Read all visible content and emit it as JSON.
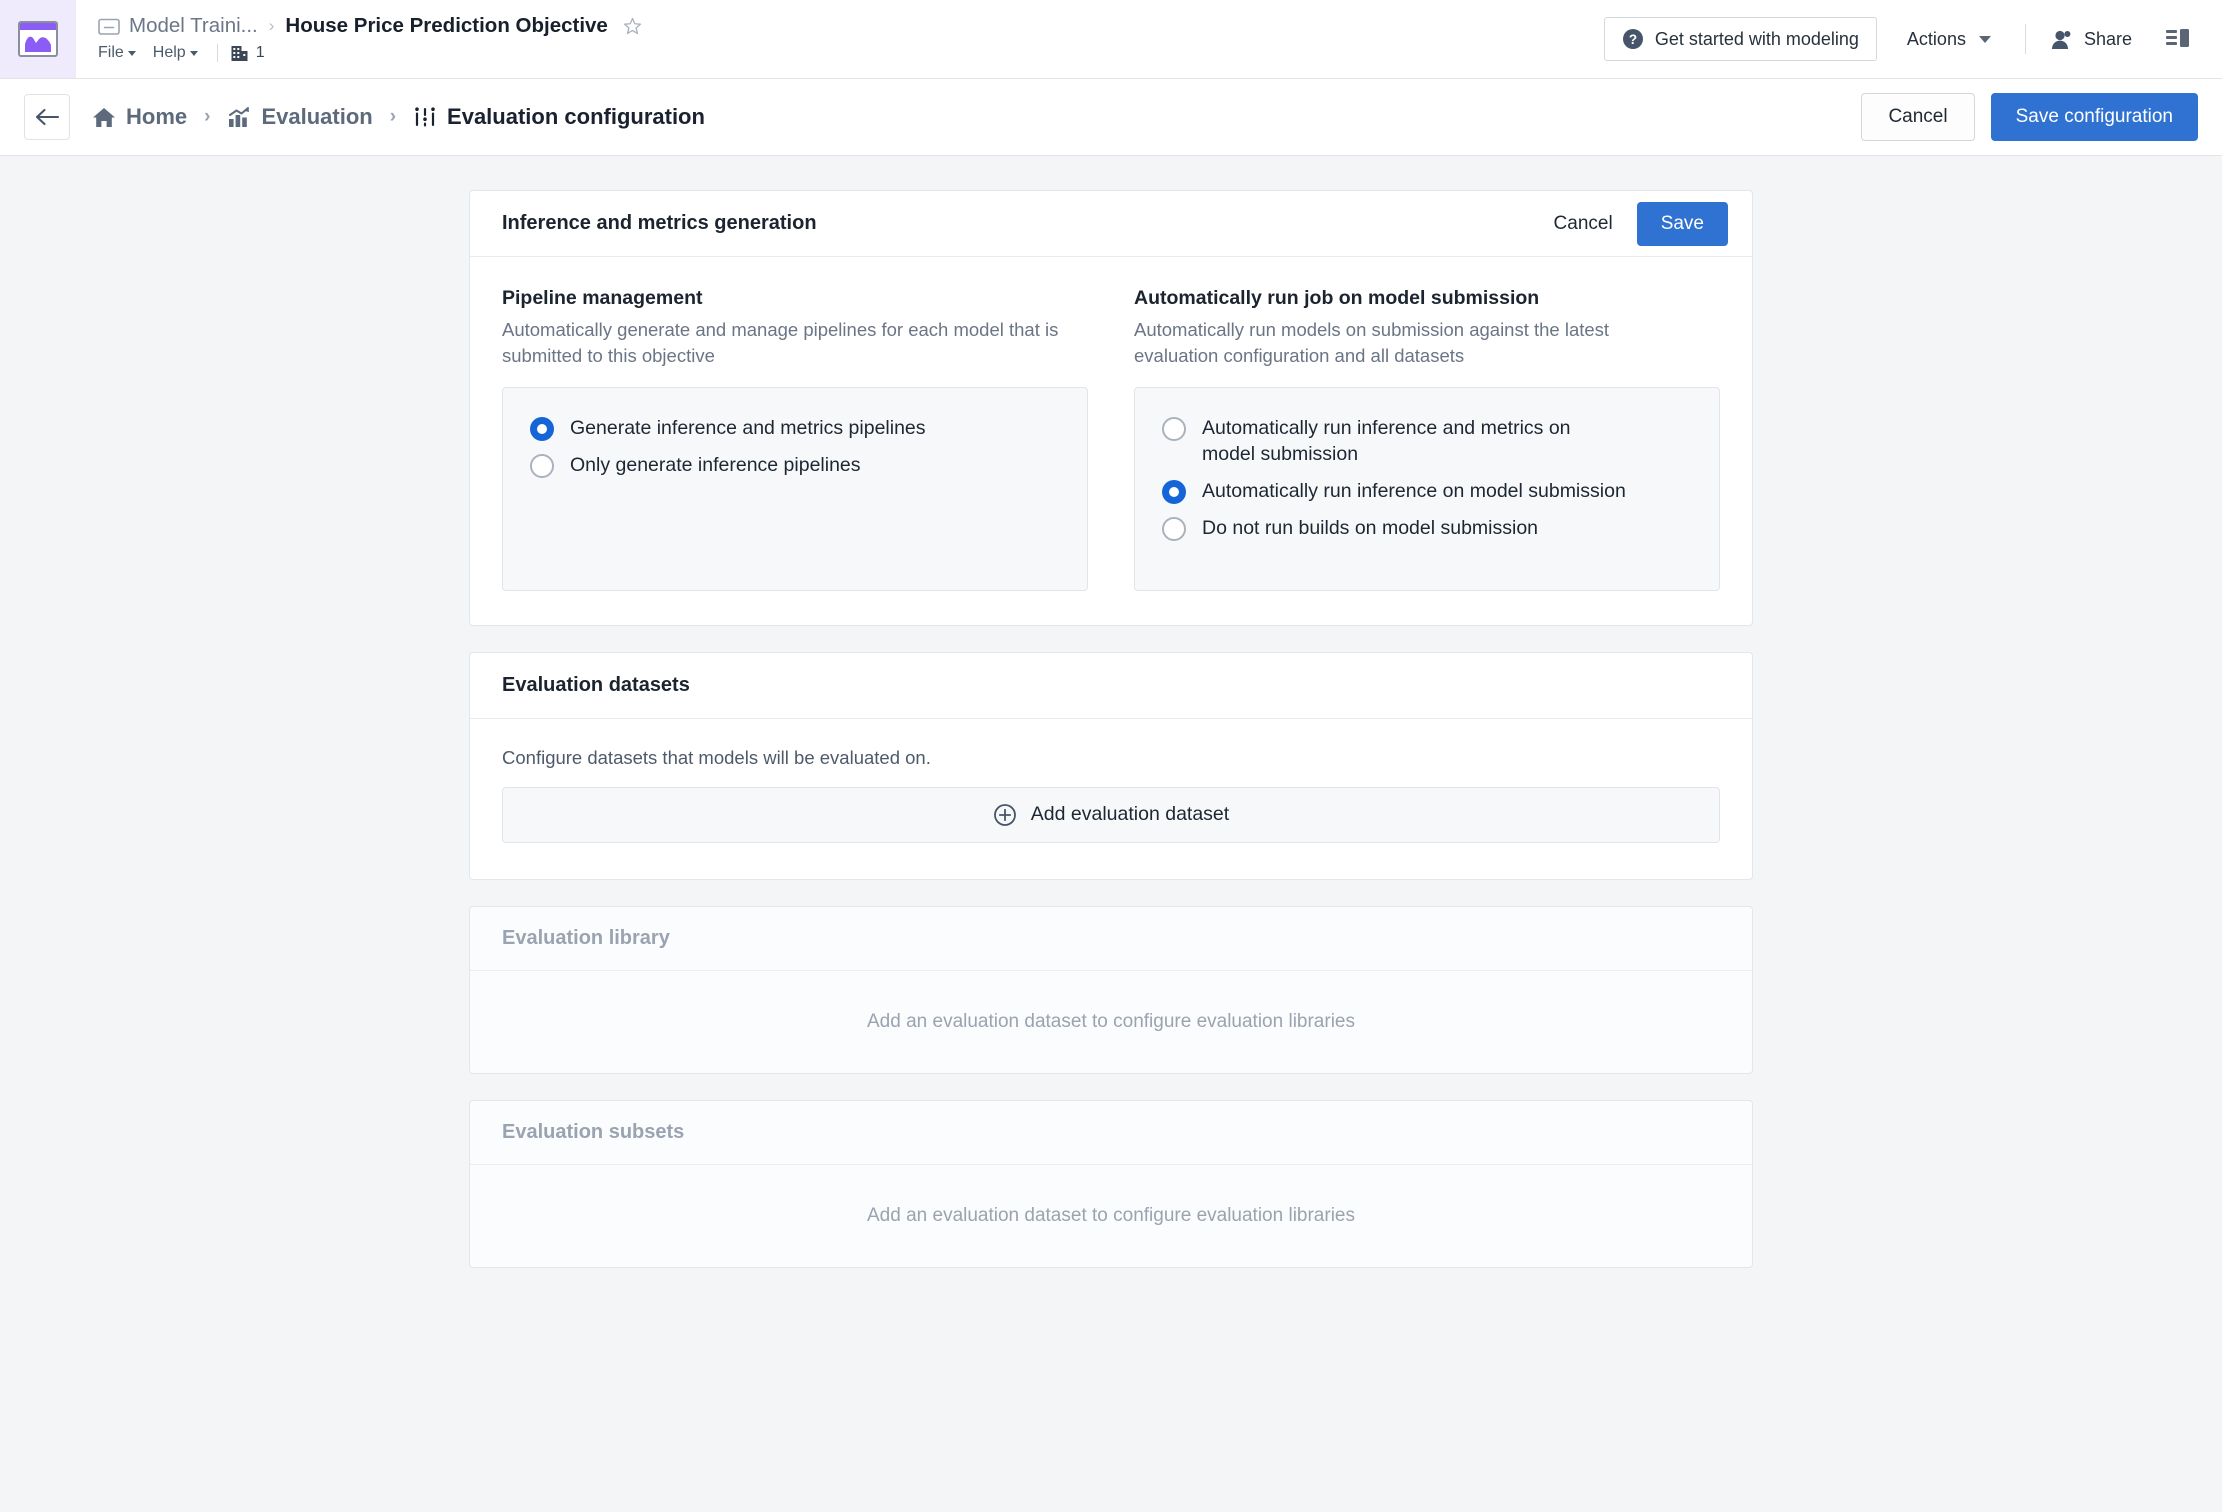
{
  "topbar": {
    "app_icon": "chart-app-icon",
    "breadcrumb_parent": "Model Traini...",
    "breadcrumb_sep": "›",
    "document_title": "House Price Prediction Objective",
    "star_icon": "star-outline-icon",
    "menus": [
      {
        "label": "File"
      },
      {
        "label": "Help"
      }
    ],
    "org_icon": "building-icon",
    "org_count": "1",
    "get_started_label": "Get started with modeling",
    "get_started_icon": "help-circle-icon",
    "actions_label": "Actions",
    "share_label": "Share",
    "share_icon": "person-icon",
    "panel_icon": "side-panel-icon"
  },
  "crumbbar": {
    "back_icon": "arrow-left-icon",
    "items": [
      {
        "label": "Home",
        "icon": "home-icon"
      },
      {
        "label": "Evaluation",
        "icon": "chart-trend-icon"
      },
      {
        "label": "Evaluation configuration",
        "icon": "sliders-icon"
      }
    ],
    "separator": "›",
    "cancel_label": "Cancel",
    "save_label": "Save configuration"
  },
  "inference_card": {
    "title": "Inference and metrics generation",
    "cancel_label": "Cancel",
    "save_label": "Save",
    "pipeline": {
      "title": "Pipeline management",
      "description": "Automatically generate and manage pipelines for each model that is submitted to this objective",
      "options": [
        {
          "label": "Generate inference and metrics pipelines",
          "selected": true
        },
        {
          "label": "Only generate inference pipelines",
          "selected": false
        }
      ]
    },
    "autorun": {
      "title": "Automatically run job on model submission",
      "description": "Automatically run models on submission against the latest evaluation configuration and all datasets",
      "options": [
        {
          "label": "Automatically run inference and metrics on model submission",
          "selected": false
        },
        {
          "label": "Automatically run inference on model submission",
          "selected": true
        },
        {
          "label": "Do not run builds on model submission",
          "selected": false
        }
      ]
    }
  },
  "datasets_card": {
    "title": "Evaluation datasets",
    "description": "Configure datasets that models will be evaluated on.",
    "add_button_label": "Add evaluation dataset",
    "add_button_icon": "plus-circle-icon"
  },
  "library_card": {
    "title": "Evaluation library",
    "empty_text": "Add an evaluation dataset to configure evaluation libraries"
  },
  "subsets_card": {
    "title": "Evaluation subsets",
    "empty_text": "Add an evaluation dataset to configure evaluation libraries"
  },
  "colors": {
    "accent_blue": "#2f72d2",
    "radio_blue": "#1565d8",
    "app_purple": "#8b5cf6",
    "app_icon_bg": "#efeafc",
    "page_bg": "#f4f5f7",
    "muted_text": "#9aa3b0"
  }
}
